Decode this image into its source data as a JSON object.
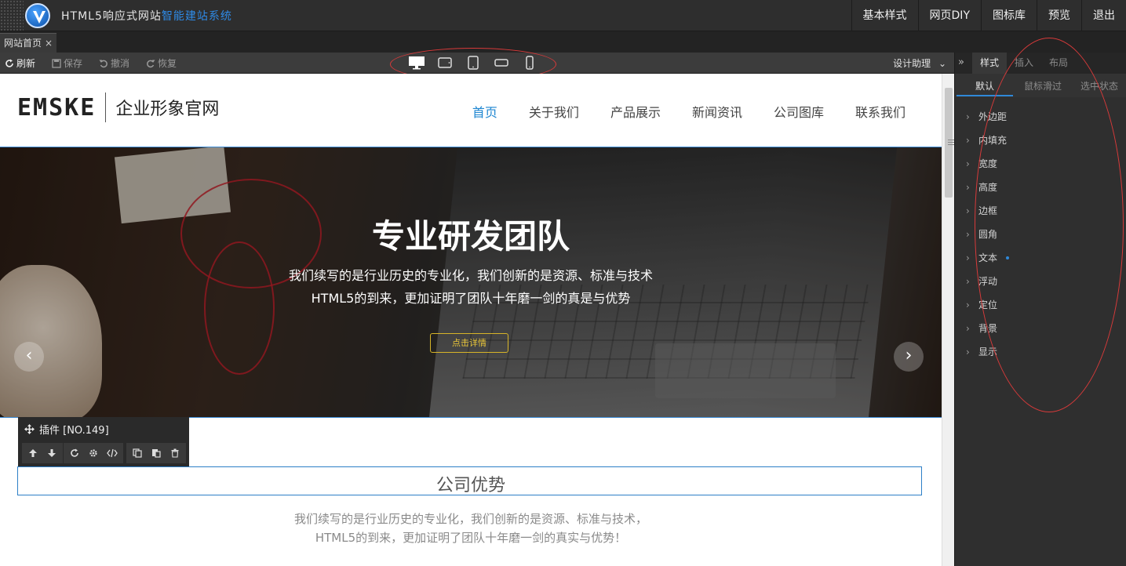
{
  "app": {
    "title_main": "HTML5响应式网站",
    "title_accent": "智能建站系统",
    "topnav": [
      "基本样式",
      "网页DIY",
      "图标库",
      "预览",
      "退出"
    ]
  },
  "doc_tab": {
    "label": "网站首页",
    "close": "×"
  },
  "toolbar": {
    "refresh": "刷新",
    "save": "保存",
    "undo": "撤消",
    "redo": "恢复",
    "assist": "设计助理"
  },
  "site": {
    "brand_mark": "EMSKE",
    "brand_name": "企业形象官网",
    "nav": [
      "首页",
      "关于我们",
      "产品展示",
      "新闻资讯",
      "公司图库",
      "联系我们"
    ],
    "banner": {
      "title": "专业研发团队",
      "line1": "我们续写的是行业历史的专业化，我们创新的是资源、标准与技术",
      "line2": "HTML5的到来，更加证明了团队十年磨一剑的真是与优势",
      "button": "点击详情",
      "prev": "‹",
      "next": "›"
    },
    "plugin": {
      "label": "插件 [NO.149]"
    },
    "section": {
      "title": "公司优势",
      "desc1": "我们续写的是行业历史的专业化，我们创新的是资源、标准与技术，",
      "desc2": "HTML5的到来，更加证明了团队十年磨一剑的真实与优势！"
    }
  },
  "panel": {
    "tabs": [
      "样式",
      "插入",
      "布局"
    ],
    "subtabs": [
      "默认",
      "鼠标滑过",
      "选中状态"
    ],
    "properties": [
      "外边距",
      "内填充",
      "宽度",
      "高度",
      "边框",
      "圆角",
      "文本",
      "浮动",
      "定位",
      "背景",
      "显示"
    ]
  },
  "colors": {
    "accent": "#1e86d1",
    "annotation": "#d83a3a",
    "button_gold": "#e9c63a"
  }
}
